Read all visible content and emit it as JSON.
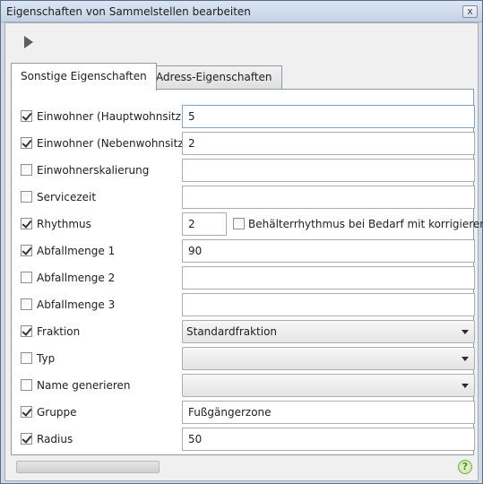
{
  "window": {
    "title": "Eigenschaften von Sammelstellen bearbeiten",
    "close_glyph": "x"
  },
  "toolbar": {
    "play_icon": "play-icon"
  },
  "tabs": [
    {
      "label": "Sonstige Eigenschaften",
      "active": true
    },
    {
      "label": "Adress-Eigenschaften",
      "active": false
    }
  ],
  "fields": {
    "einwohner_haupt": {
      "label": "Einwohner (Hauptwohnsitz)",
      "checked": true,
      "value": "5"
    },
    "einwohner_neben": {
      "label": "Einwohner (Nebenwohnsitz)",
      "checked": true,
      "value": "2"
    },
    "einwohnerskalierung": {
      "label": "Einwohnerskalierung",
      "checked": false,
      "value": ""
    },
    "servicezeit": {
      "label": "Servicezeit",
      "checked": false,
      "value": ""
    },
    "rhythmus": {
      "label": "Rhythmus",
      "checked": true,
      "value": "2",
      "option_label": "Behälterrhythmus bei Bedarf mit korrigieren",
      "option_checked": false
    },
    "abfallmenge1": {
      "label": "Abfallmenge 1",
      "checked": true,
      "value": "90"
    },
    "abfallmenge2": {
      "label": "Abfallmenge 2",
      "checked": false,
      "value": ""
    },
    "abfallmenge3": {
      "label": "Abfallmenge 3",
      "checked": false,
      "value": ""
    },
    "fraktion": {
      "label": "Fraktion",
      "checked": true,
      "value": "Standardfraktion"
    },
    "typ": {
      "label": "Typ",
      "checked": false,
      "value": ""
    },
    "name_generieren": {
      "label": "Name generieren",
      "checked": false,
      "value": ""
    },
    "gruppe": {
      "label": "Gruppe",
      "checked": true,
      "value": "Fußgängerzone"
    },
    "radius": {
      "label": "Radius",
      "checked": true,
      "value": "50"
    }
  },
  "status": {
    "help_glyph": "?"
  },
  "colors": {
    "title_bar": "#c3d2e4",
    "panel": "#ffffff",
    "help_accent": "#6fae3c"
  }
}
